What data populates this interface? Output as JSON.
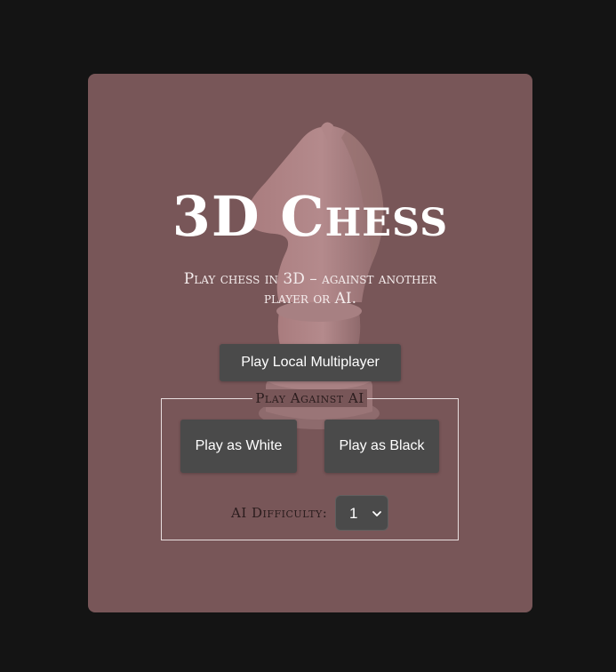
{
  "app": {
    "title": "3D Chess",
    "subtitle": "Play chess in 3D – against another player or AI."
  },
  "buttons": {
    "local_multiplayer": "Play Local Multiplayer",
    "play_white": "Play as White",
    "play_black": "Play as Black"
  },
  "ai_section": {
    "legend": "Play Against AI",
    "difficulty_label": "AI Difficulty:",
    "difficulty_value": "1"
  },
  "icons": {
    "background": "knight-piece-icon",
    "select": "chevron-down-icon"
  },
  "colors": {
    "page_background": "#141414",
    "card_background": "#785658",
    "button_background": "#4a4a4a",
    "text_light": "#ffffff",
    "text_dark": "#2a1c1d"
  }
}
